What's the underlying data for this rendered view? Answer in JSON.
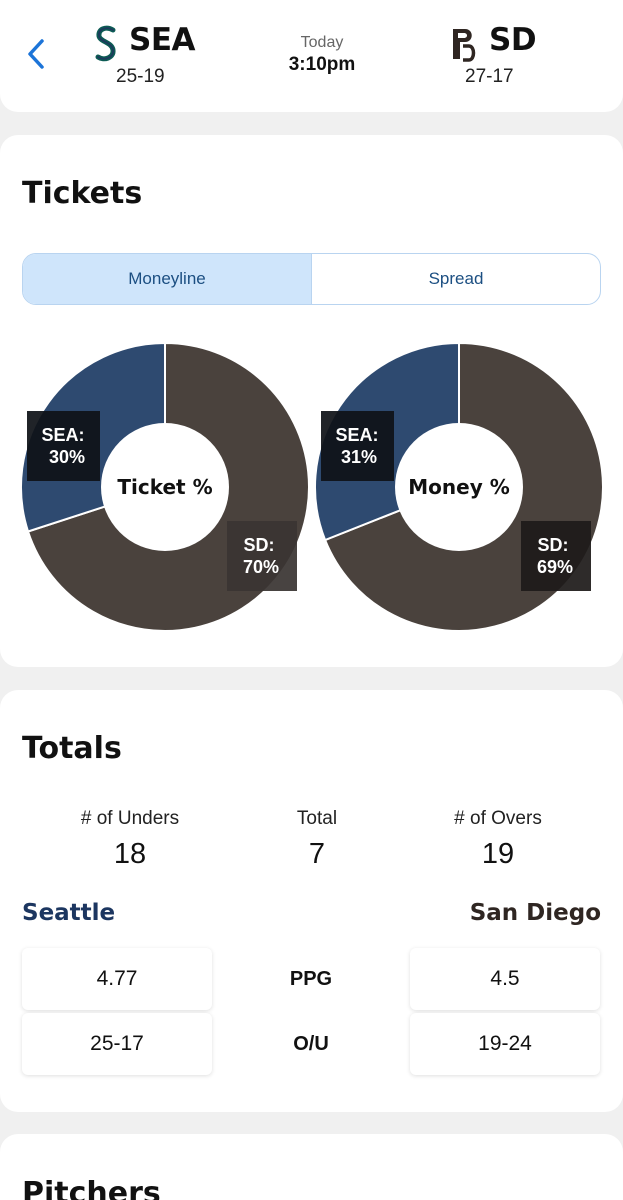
{
  "header": {
    "away": {
      "abbr": "SEA",
      "record": "25-19"
    },
    "home": {
      "abbr": "SD",
      "record": "27-17"
    },
    "day": "Today",
    "time": "3:10pm"
  },
  "tickets": {
    "title": "Tickets",
    "tabs": [
      {
        "label": "Moneyline",
        "active": true
      },
      {
        "label": "Spread",
        "active": false
      }
    ],
    "charts": [
      {
        "center": "Ticket %",
        "away_label": "SEA:",
        "away_pct": "30%",
        "home_label": "SD:",
        "home_pct": "70%",
        "away_value": 30,
        "home_value": 70
      },
      {
        "center": "Money %",
        "away_label": "SEA:",
        "away_pct": "31%",
        "home_label": "SD:",
        "home_pct": "69%",
        "away_value": 31,
        "home_value": 69
      }
    ]
  },
  "totals": {
    "title": "Totals",
    "unders_label": "# of Unders",
    "unders_value": "18",
    "total_label": "Total",
    "total_value": "7",
    "overs_label": "# of Overs",
    "overs_value": "19",
    "away_name": "Seattle",
    "home_name": "San Diego",
    "rows": [
      {
        "away": "4.77",
        "label": "PPG",
        "home": "4.5"
      },
      {
        "away": "25-17",
        "label": "O/U",
        "home": "19-24"
      }
    ]
  },
  "pitchers": {
    "title": "Pitchers"
  },
  "colors": {
    "away_team": "#2e4a70",
    "home_team": "#4a423d",
    "accent": "#1c74d8",
    "seattle_text": "#1c3660",
    "sandiego_text": "#2f2622"
  }
}
